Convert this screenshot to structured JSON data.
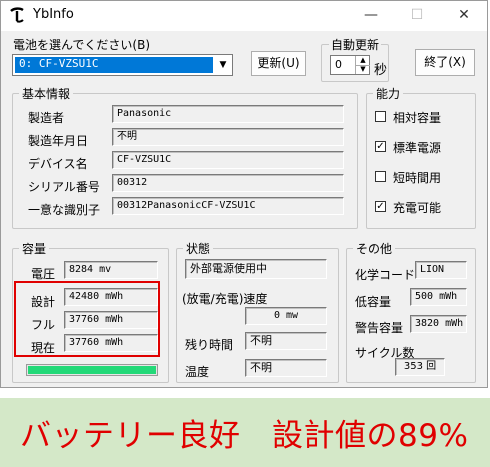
{
  "window": {
    "title": "YbInfo",
    "minimize": "—",
    "maximize": "☐",
    "close": "✕"
  },
  "battery_select": {
    "label": "電池を選んでください(B)",
    "value": "0: CF-VZSU1C",
    "arrow": "▼"
  },
  "update_button": {
    "label": "更新(U)"
  },
  "auto_update": {
    "label": "自動更新",
    "value": "0",
    "unit": "秒"
  },
  "exit_button": {
    "label": "終了(X)"
  },
  "basic_info": {
    "title": "基本情報",
    "rows": [
      {
        "label": "製造者",
        "value": "Panasonic"
      },
      {
        "label": "製造年月日",
        "value": "不明"
      },
      {
        "label": "デバイス名",
        "value": "CF-VZSU1C"
      },
      {
        "label": "シリアル番号",
        "value": "00312"
      },
      {
        "label": "一意な識別子",
        "value": "00312PanasonicCF-VZSU1C"
      }
    ]
  },
  "capability": {
    "title": "能力",
    "items": [
      {
        "label": "相対容量",
        "checked": ""
      },
      {
        "label": "標準電源",
        "checked": "✓"
      },
      {
        "label": "短時間用",
        "checked": ""
      },
      {
        "label": "充電可能",
        "checked": "✓"
      }
    ]
  },
  "capacity": {
    "title": "容量",
    "voltage": {
      "label": "電圧",
      "value": "8284 mv"
    },
    "design": {
      "label": "設計",
      "value": "42480 mWh"
    },
    "full": {
      "label": "フル",
      "value": "37760 mWh"
    },
    "current": {
      "label": "現在",
      "value": "37760 mWh"
    },
    "level": 1.0,
    "bar_color": "#23d978",
    "highlight_color": "#e00000"
  },
  "status": {
    "title": "状態",
    "power": "外部電源使用中",
    "rate_label": "(放電/充電)速度",
    "rate_value": "0 mw",
    "remaining_label": "残り時間",
    "remaining_value": "不明",
    "temp_label": "温度",
    "temp_value": "不明"
  },
  "other": {
    "title": "その他",
    "chem_label": "化学コード",
    "chem_value": "LION",
    "low_label": "低容量",
    "low_value": "500 mWh",
    "warn_label": "警告容量",
    "warn_value": "3820 mWh",
    "cycle_label": "サイクル数",
    "cycle_value": "353 回"
  },
  "banner": {
    "text": "バッテリー良好　設計値の89%",
    "background": "#d4e8c8",
    "text_color": "#e00000"
  }
}
